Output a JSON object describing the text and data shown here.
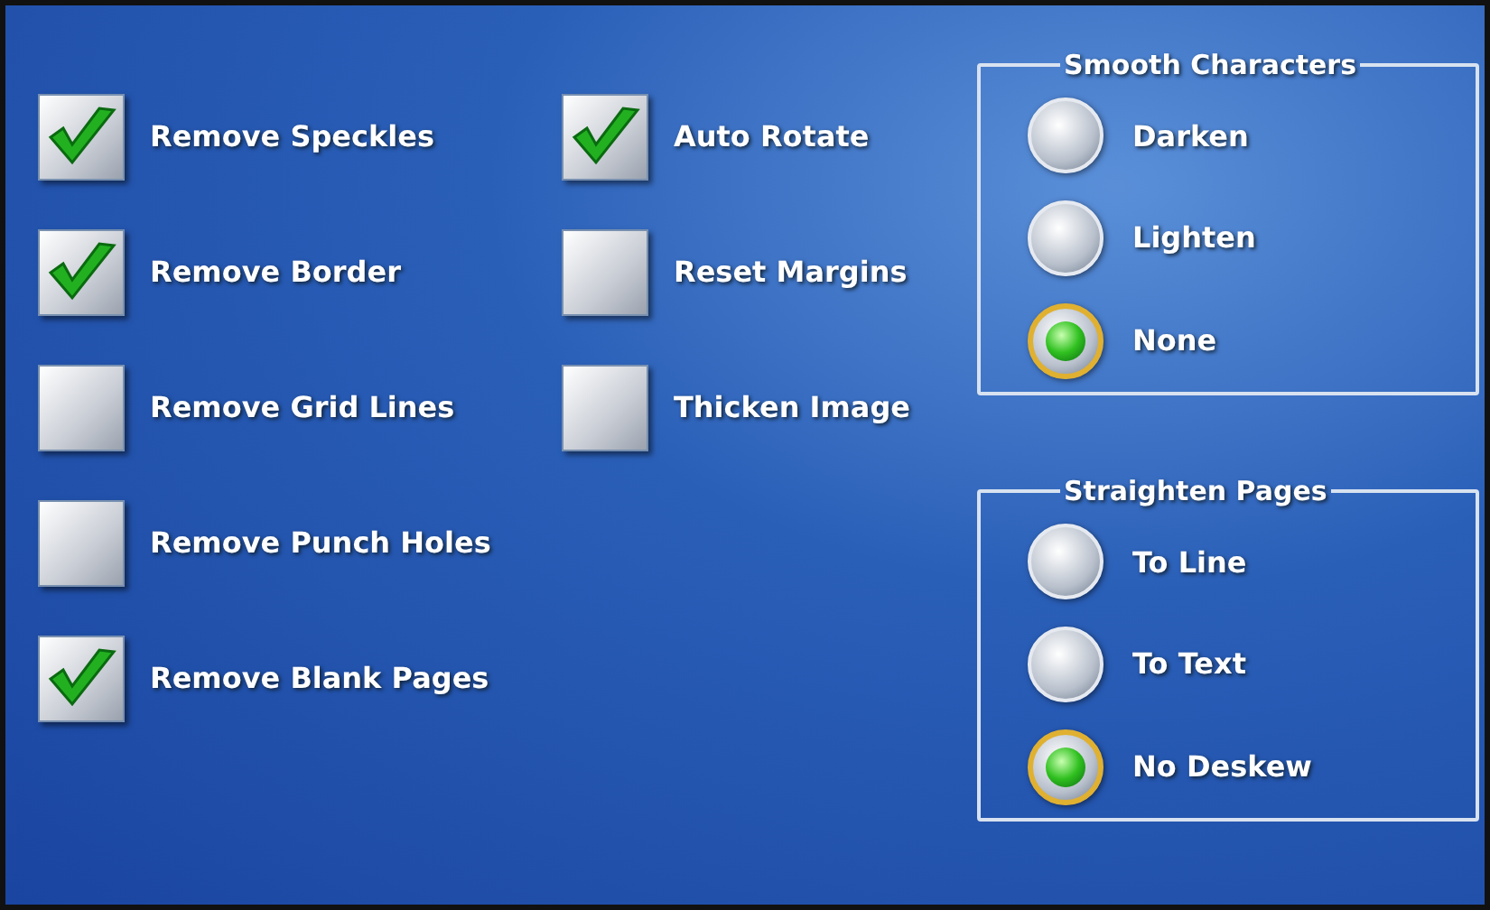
{
  "checkbox_columns": [
    {
      "items": [
        {
          "label": "Remove Speckles",
          "checked": true
        },
        {
          "label": "Remove Border",
          "checked": true
        },
        {
          "label": "Remove Grid Lines",
          "checked": false
        },
        {
          "label": "Remove Punch Holes",
          "checked": false
        },
        {
          "label": "Remove Blank Pages",
          "checked": true
        }
      ]
    },
    {
      "items": [
        {
          "label": "Auto Rotate",
          "checked": true
        },
        {
          "label": "Reset Margins",
          "checked": false
        },
        {
          "label": "Thicken Image",
          "checked": false
        }
      ]
    }
  ],
  "groups": [
    {
      "title": "Smooth Characters",
      "options": [
        {
          "label": "Darken",
          "selected": false
        },
        {
          "label": "Lighten",
          "selected": false
        },
        {
          "label": "None",
          "selected": true
        }
      ]
    },
    {
      "title": "Straighten Pages",
      "options": [
        {
          "label": "To Line",
          "selected": false
        },
        {
          "label": "To Text",
          "selected": false
        },
        {
          "label": "No Deskew",
          "selected": true
        }
      ]
    }
  ]
}
